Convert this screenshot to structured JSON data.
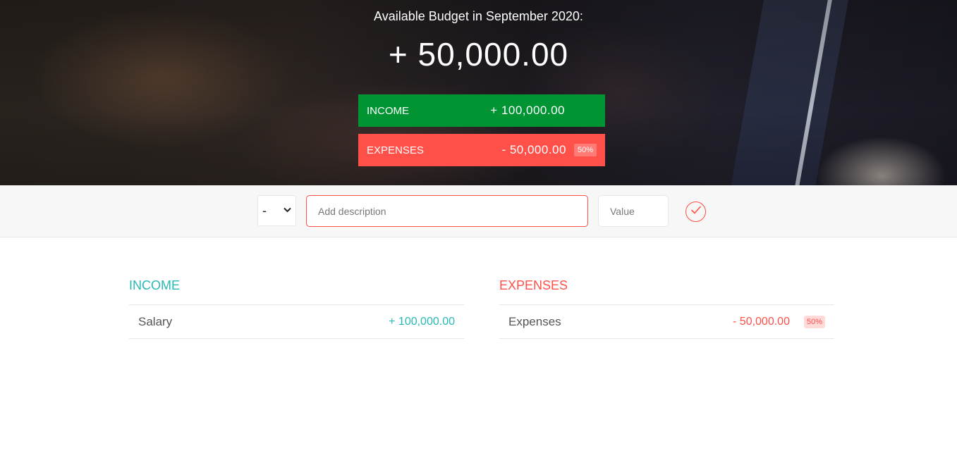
{
  "header": {
    "budget_title": "Available Budget in September 2020:",
    "budget_value": "+ 50,000.00",
    "income": {
      "label": "Income",
      "value": "+ 100,000.00"
    },
    "expenses": {
      "label": "Expenses",
      "value": "- 50,000.00",
      "percentage": "50%"
    }
  },
  "add_form": {
    "type_selected": "-",
    "description_placeholder": "Add description",
    "value_placeholder": "Value",
    "submit_icon": "checkmark-circle-icon"
  },
  "income_list": {
    "title": "Income",
    "items": [
      {
        "description": "Salary",
        "value": "+ 100,000.00"
      }
    ]
  },
  "expenses_list": {
    "title": "Expenses",
    "items": [
      {
        "description": "Expenses",
        "value": "- 50,000.00",
        "percentage": "50%"
      }
    ]
  },
  "colors": {
    "income_green": "#009432",
    "expense_red": "#ff5049",
    "income_teal": "#28b9b5"
  }
}
